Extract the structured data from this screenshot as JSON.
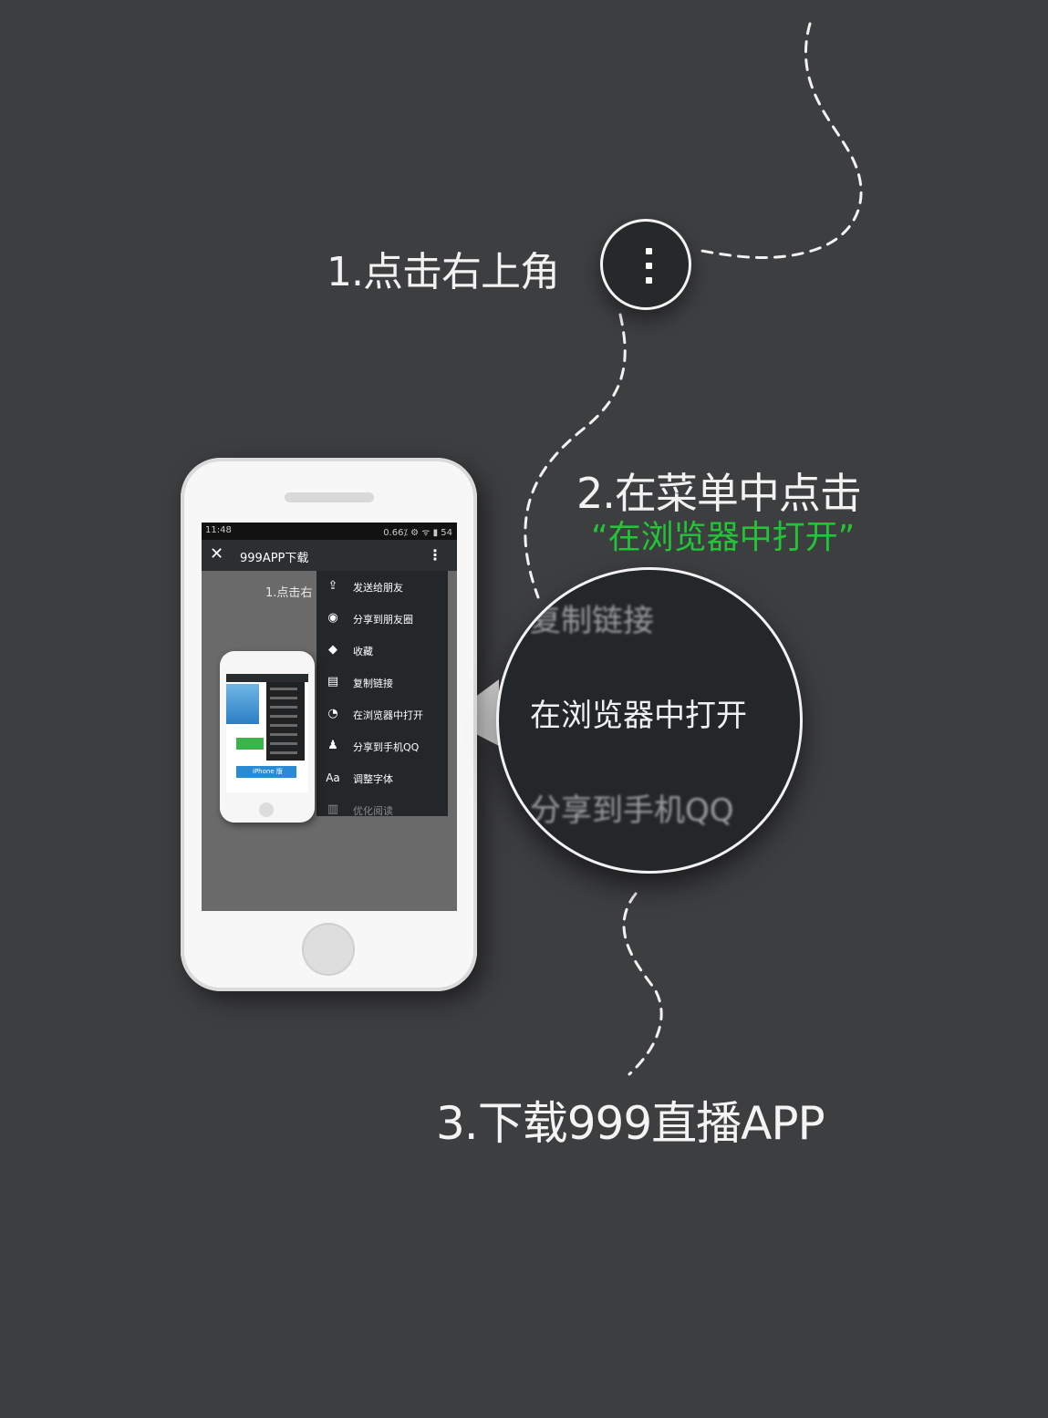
{
  "steps": {
    "step1": "1.点击右上角",
    "step2": "2.在菜单中点击",
    "step2_highlight": "“在浏览器中打开”",
    "step3": "3.下载999直播APP"
  },
  "colors": {
    "background": "#3d3e40",
    "highlight": "#21c637",
    "menu_bg": "#242729"
  },
  "phone": {
    "status_time": "11:48",
    "status_right": "0.66⁒ ⚙ ᯤ ▮ 54",
    "title": "999APP下载",
    "close_icon": "close-icon",
    "more_icon": "more-vertical-icon",
    "background_text": "1.点击右",
    "menu": [
      {
        "icon": "share-icon",
        "label": "发送给朋友"
      },
      {
        "icon": "moments-icon",
        "label": "分享到朋友圈"
      },
      {
        "icon": "favorite-icon",
        "label": "收藏"
      },
      {
        "icon": "copy-link-icon",
        "label": "复制链接"
      },
      {
        "icon": "browser-icon",
        "label": "在浏览器中打开"
      },
      {
        "icon": "qq-icon",
        "label": "分享到手机QQ"
      },
      {
        "icon": "font-icon",
        "label": "调整字体"
      },
      {
        "icon": "reader-icon",
        "label": "优化阅读"
      }
    ],
    "mini_iphone_label": "iPhone 版"
  },
  "magnifier": {
    "line1": "复制链接",
    "line2": "在浏览器中打开",
    "line3": "分享到手机QQ"
  }
}
